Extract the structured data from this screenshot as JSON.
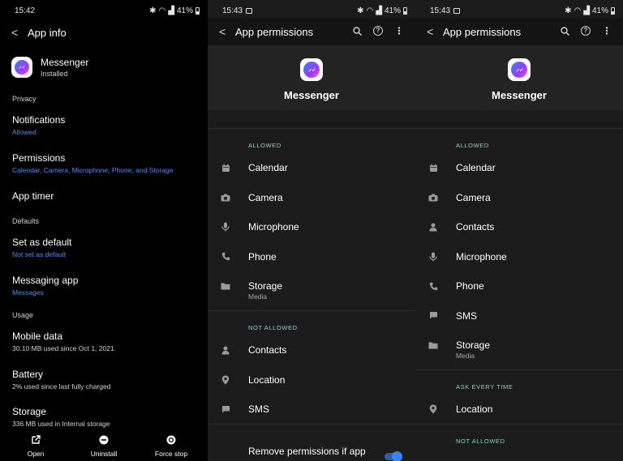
{
  "panel1": {
    "status": {
      "time": "15:42",
      "battery": "41%"
    },
    "header": {
      "title": "App info"
    },
    "app": {
      "name": "Messenger",
      "status": "Installed"
    },
    "sections": {
      "privacy": "Privacy",
      "defaults": "Defaults",
      "usage": "Usage"
    },
    "items": {
      "notifications": {
        "title": "Notifications",
        "sub": "Allowed"
      },
      "permissions": {
        "title": "Permissions",
        "sub": "Calendar, Camera, Microphone, Phone, and Storage"
      },
      "app_timer": {
        "title": "App timer"
      },
      "set_default": {
        "title": "Set as default",
        "sub": "Not set as default"
      },
      "messaging": {
        "title": "Messaging app",
        "sub": "Messages"
      },
      "mobile_data": {
        "title": "Mobile data",
        "sub": "30.10 MB used since Oct 1, 2021"
      },
      "battery": {
        "title": "Battery",
        "sub": "2% used since last fully charged"
      },
      "storage": {
        "title": "Storage",
        "sub": "336 MB used in Internal storage"
      }
    },
    "bottom": {
      "open": "Open",
      "uninstall": "Uninstall",
      "force_stop": "Force stop"
    }
  },
  "panel2": {
    "status": {
      "time": "15:43",
      "battery": "41%"
    },
    "header": {
      "title": "App permissions"
    },
    "app_name": "Messenger",
    "allowed_label": "ALLOWED",
    "allowed": [
      {
        "label": "Calendar",
        "icon": "calendar-icon"
      },
      {
        "label": "Camera",
        "icon": "camera-icon"
      },
      {
        "label": "Microphone",
        "icon": "microphone-icon"
      },
      {
        "label": "Phone",
        "icon": "phone-icon"
      },
      {
        "label": "Storage",
        "sub": "Media",
        "icon": "folder-icon"
      }
    ],
    "not_allowed_label": "NOT ALLOWED",
    "not_allowed": [
      {
        "label": "Contacts",
        "icon": "person-icon"
      },
      {
        "label": "Location",
        "icon": "location-pin-icon"
      },
      {
        "label": "SMS",
        "icon": "message-icon"
      }
    ],
    "remove_permissions": "Remove permissions if app"
  },
  "panel3": {
    "status": {
      "time": "15:43",
      "battery": "41%"
    },
    "header": {
      "title": "App permissions"
    },
    "app_name": "Messenger",
    "allowed_label": "ALLOWED",
    "allowed": [
      {
        "label": "Calendar",
        "icon": "calendar-icon"
      },
      {
        "label": "Camera",
        "icon": "camera-icon"
      },
      {
        "label": "Contacts",
        "icon": "person-icon"
      },
      {
        "label": "Microphone",
        "icon": "microphone-icon"
      },
      {
        "label": "Phone",
        "icon": "phone-icon"
      },
      {
        "label": "SMS",
        "icon": "message-icon"
      },
      {
        "label": "Storage",
        "sub": "Media",
        "icon": "folder-icon"
      }
    ],
    "ask_label": "ASK EVERY TIME",
    "ask": [
      {
        "label": "Location",
        "icon": "location-pin-icon"
      }
    ],
    "not_allowed_label": "NOT ALLOWED"
  },
  "colors": {
    "accent_blue": "#4d8df0",
    "category_teal": "#8fd1c8",
    "toggle_blue": "#3b82f6"
  }
}
